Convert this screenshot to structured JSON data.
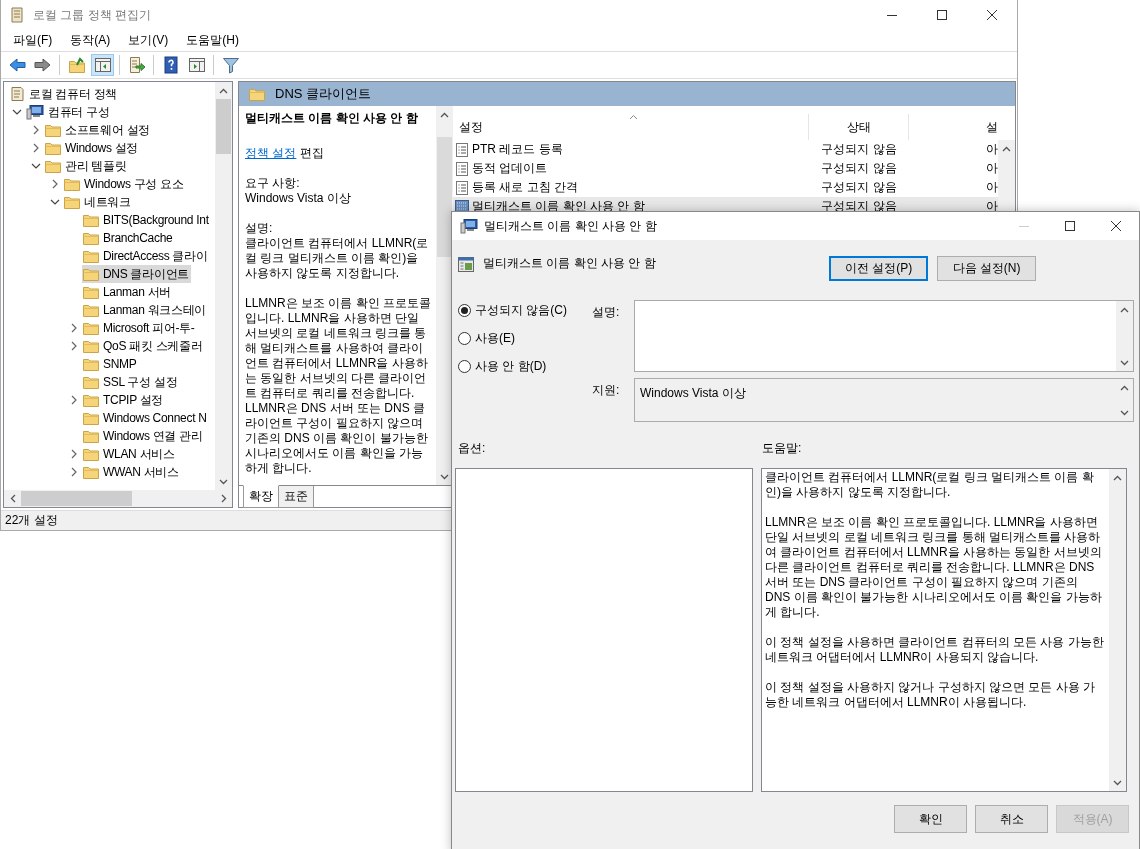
{
  "main_window": {
    "title": "로컬 그룹 정책 편집기",
    "menu": [
      "파일(F)",
      "동작(A)",
      "보기(V)",
      "도움말(H)"
    ],
    "toolbar": [
      {
        "kind": "back",
        "pressed": false
      },
      {
        "kind": "forward",
        "pressed": false
      },
      {
        "kind": "up",
        "pressed": false
      },
      {
        "kind": "tree",
        "pressed": true
      },
      {
        "kind": "export",
        "pressed": false
      },
      {
        "kind": "help",
        "pressed": false
      },
      {
        "kind": "pane",
        "pressed": false
      },
      {
        "kind": "filter",
        "pressed": false
      }
    ],
    "tree": [
      {
        "label": "로컬 컴퓨터 정책",
        "kind": "policy",
        "selected": false,
        "children": [
          {
            "label": "컴퓨터 구성",
            "kind": "computer",
            "selected": false,
            "expanded": true,
            "children": [
              {
                "label": "소프트웨어 설정",
                "kind": "folder",
                "selected": false,
                "expanded": false
              },
              {
                "label": "Windows 설정",
                "kind": "folder",
                "selected": false,
                "expanded": false
              },
              {
                "label": "관리 템플릿",
                "kind": "folder",
                "selected": false,
                "expanded": true,
                "children": [
                  {
                    "label": "Windows 구성 요소",
                    "kind": "folder",
                    "selected": false,
                    "expanded": false
                  },
                  {
                    "label": "네트워크",
                    "kind": "folder",
                    "selected": false,
                    "expanded": true,
                    "children": [
                      {
                        "label": "BITS(Background Int",
                        "kind": "folder",
                        "selected": false
                      },
                      {
                        "label": "BranchCache",
                        "kind": "folder",
                        "selected": false
                      },
                      {
                        "label": "DirectAccess 클라이",
                        "kind": "folder",
                        "selected": false
                      },
                      {
                        "label": "DNS 클라이언트",
                        "kind": "folder",
                        "selected": true
                      },
                      {
                        "label": "Lanman 서버",
                        "kind": "folder",
                        "selected": false
                      },
                      {
                        "label": "Lanman 워크스테이",
                        "kind": "folder",
                        "selected": false
                      },
                      {
                        "label": "Microsoft 피어-투-",
                        "kind": "folder",
                        "selected": false,
                        "expanded": false
                      },
                      {
                        "label": "QoS 패킷 스케줄러",
                        "kind": "folder",
                        "selected": false,
                        "expanded": false
                      },
                      {
                        "label": "SNMP",
                        "kind": "folder",
                        "selected": false
                      },
                      {
                        "label": "SSL 구성 설정",
                        "kind": "folder",
                        "selected": false
                      },
                      {
                        "label": "TCPIP 설정",
                        "kind": "folder",
                        "selected": false,
                        "expanded": false
                      },
                      {
                        "label": "Windows Connect N",
                        "kind": "folder",
                        "selected": false
                      },
                      {
                        "label": "Windows 연결 관리",
                        "kind": "folder",
                        "selected": false
                      },
                      {
                        "label": "WLAN 서비스",
                        "kind": "folder",
                        "selected": false,
                        "expanded": false
                      },
                      {
                        "label": "WWAN 서비스",
                        "kind": "folder",
                        "selected": false,
                        "expanded": false
                      }
                    ]
                  }
                ]
              }
            ]
          }
        ]
      }
    ],
    "header": "DNS 클라이언트",
    "detail": {
      "policy_title": "멀티캐스트 이름 확인 사용 안 함",
      "edit_link": "정책 설정",
      "edit_text": "편집",
      "requirement_label": "요구 사항:",
      "requirement": "Windows Vista 이상",
      "description_label": "설명:",
      "description": [
        "클라이언트 컴퓨터에서 LLMNR(로컬 링크 멀티캐스트 이름 확인)을 사용하지 않도록 지정합니다.",
        "LLMNR은 보조 이름 확인 프로토콜입니다. LLMNR을 사용하면 단일 서브넷의 로컬 네트워크 링크를 통해 멀티캐스트를 사용하여 클라이언트 컴퓨터에서 LLMNR을 사용하는 동일한 서브넷의 다른 클라이언트 컴퓨터로 쿼리를 전송합니다. LLMNR은 DNS 서버 또는 DNS 클라이언트 구성이 필요하지 않으며 기존의 DNS 이름 확인이 불가능한 시나리오에서도 이름 확인을 가능하게 합니다."
      ]
    },
    "table": {
      "columns": [
        "설정",
        "상태",
        "설"
      ],
      "rows": [
        {
          "name": "PTR 레코드 등록",
          "state": "구성되지 않음",
          "comment": "아",
          "selected": false
        },
        {
          "name": "동적 업데이트",
          "state": "구성되지 않음",
          "comment": "아",
          "selected": false
        },
        {
          "name": "등록 새로 고침 간격",
          "state": "구성되지 않음",
          "comment": "아",
          "selected": false
        },
        {
          "name": "멀티캐스트 이름 확인 사용 안 함",
          "state": "구성되지 않음",
          "comment": "아",
          "selected": true
        }
      ]
    },
    "tabs": [
      {
        "label": "확장",
        "selected": true
      },
      {
        "label": "표준",
        "selected": false
      }
    ],
    "status_bar": "22개 설정"
  },
  "dialog": {
    "title": "멀티캐스트 이름 확인 사용 안 함",
    "heading": "멀티캐스트 이름 확인 사용 안 함",
    "nav_buttons": [
      {
        "label": "이전 설정(P)",
        "focused": true
      },
      {
        "label": "다음 설정(N)",
        "focused": false
      }
    ],
    "radios": [
      {
        "label": "구성되지 않음(C)",
        "selected": true
      },
      {
        "label": "사용(E)",
        "selected": false
      },
      {
        "label": "사용 안 함(D)",
        "selected": false
      }
    ],
    "comment_label": "설명:",
    "support_label": "지원:",
    "support": "Windows Vista 이상",
    "options_label": "옵션:",
    "help_label": "도움말:",
    "help": [
      "클라이언트 컴퓨터에서 LLMNR(로컬 링크 멀티캐스트 이름 확인)을 사용하지 않도록 지정합니다.",
      "LLMNR은 보조 이름 확인 프로토콜입니다. LLMNR을 사용하면 단일 서브넷의 로컬 네트워크 링크를 통해 멀티캐스트를 사용하여 클라이언트 컴퓨터에서 LLMNR을 사용하는 동일한 서브넷의 다른 클라이언트 컴퓨터로 쿼리를 전송합니다. LLMNR은 DNS 서버 또는 DNS 클라이언트 구성이 필요하지 않으며 기존의 DNS 이름 확인이 불가능한 시나리오에서도 이름 확인을 가능하게 합니다.",
      "이 정책 설정을 사용하면 클라이언트 컴퓨터의 모든 사용 가능한 네트워크 어댑터에서 LLMNR이 사용되지 않습니다.",
      "이 정책 설정을 사용하지 않거나 구성하지 않으면 모든 사용 가능한 네트워크 어댑터에서 LLMNR이 사용됩니다."
    ],
    "buttons": [
      {
        "label": "확인",
        "disabled": false
      },
      {
        "label": "취소",
        "disabled": false
      },
      {
        "label": "적용(A)",
        "disabled": true
      }
    ]
  }
}
